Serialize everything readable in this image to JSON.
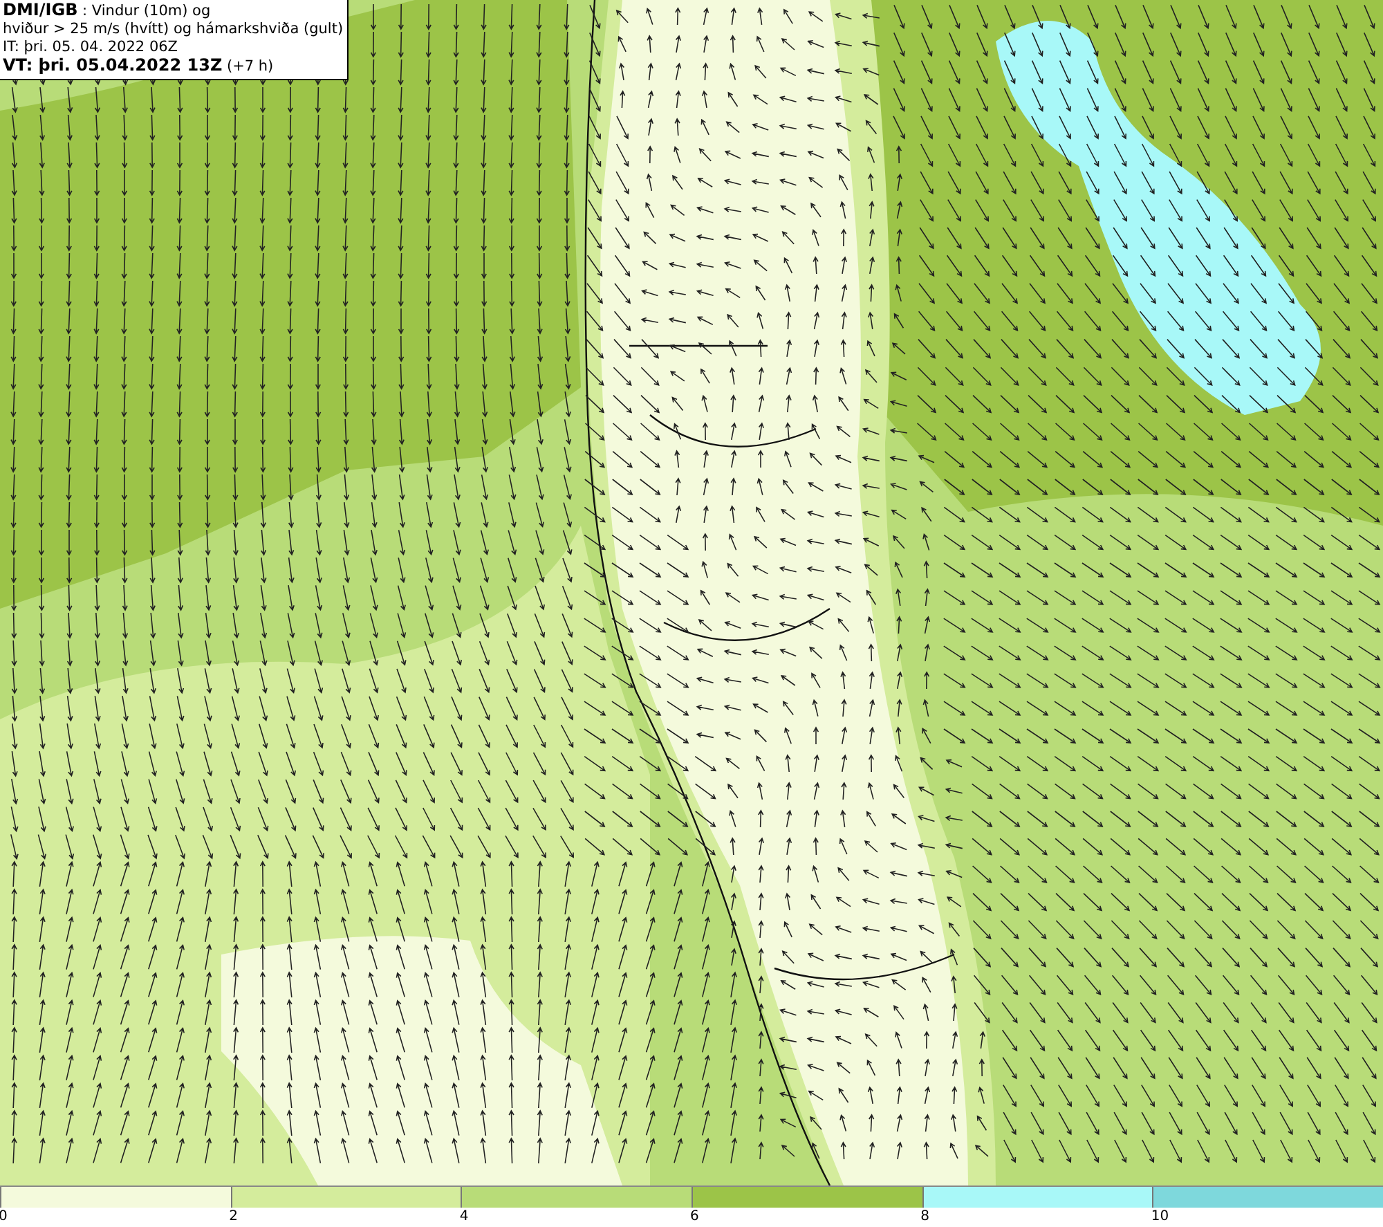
{
  "info_box": {
    "lines": [
      "**DMI/IGB** : Vindur (10m) og",
      "hviður > 25 m/s (hvítt) og hámarkshviða (gult)",
      "IT: þri. 05. 04. 2022 06Z",
      "**VT: þri. 05.04.2022 13Z** (+7 h)"
    ]
  },
  "legend": {
    "segments": [
      {
        "label": "0",
        "color": "#f4fadc"
      },
      {
        "label": "2",
        "color": "#d4ec9c"
      },
      {
        "label": "4",
        "color": "#b8dc78"
      },
      {
        "label": "6",
        "color": "#9cc448"
      },
      {
        "label": "8",
        "color": "#a8f8f8"
      },
      {
        "label": "10",
        "color": "#7ed8dc"
      }
    ]
  }
}
